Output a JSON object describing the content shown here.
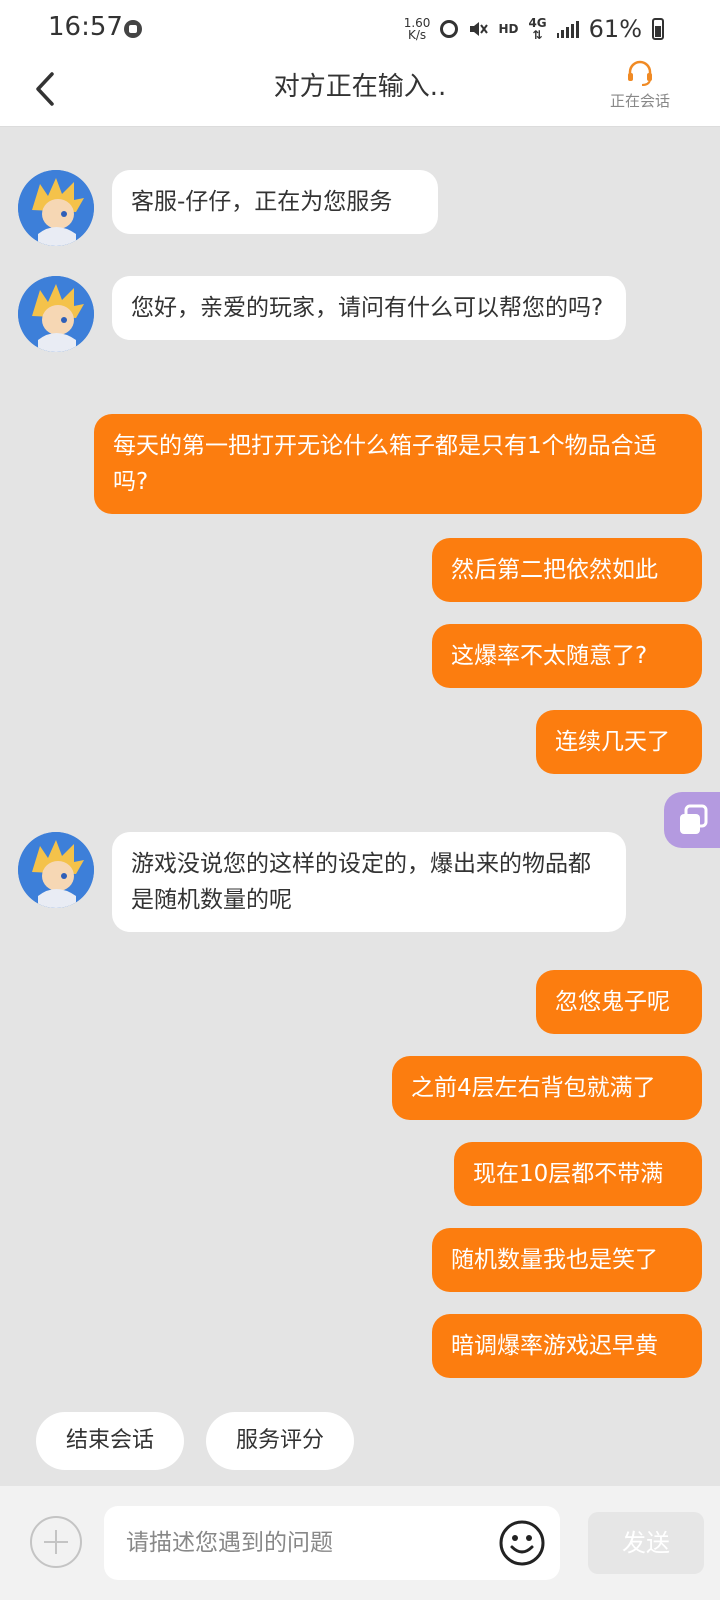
{
  "status_bar": {
    "time": "16:57",
    "net_speed_value": "1.60",
    "net_speed_unit": "K/s",
    "hd_label": "HD",
    "network_type": "4G",
    "battery_percent": "61%"
  },
  "header": {
    "title": "对方正在输入..",
    "service_status_label": "正在会话"
  },
  "messages": [
    {
      "sender": "agent",
      "text": "客服-仔仔，正在为您服务"
    },
    {
      "sender": "agent",
      "text": "您好，亲爱的玩家，请问有什么可以帮您的吗?"
    },
    {
      "sender": "user",
      "text": "每天的第一把打开无论什么箱子都是只有1个物品合适吗?"
    },
    {
      "sender": "user",
      "text": "然后第二把依然如此"
    },
    {
      "sender": "user",
      "text": "这爆率不太随意了?"
    },
    {
      "sender": "user",
      "text": "连续几天了"
    },
    {
      "sender": "agent",
      "text": "游戏没说您的这样的设定的，爆出来的物品都是随机数量的呢"
    },
    {
      "sender": "user",
      "text": "忽悠鬼子呢"
    },
    {
      "sender": "user",
      "text": "之前4层左右背包就满了"
    },
    {
      "sender": "user",
      "text": "现在10层都不带满"
    },
    {
      "sender": "user",
      "text": "随机数量我也是笑了"
    },
    {
      "sender": "user",
      "text": "暗调爆率游戏迟早黄"
    }
  ],
  "quick_actions": {
    "end_session": "结束会话",
    "rate_service": "服务评分"
  },
  "composer": {
    "placeholder": "请描述您遇到的问题",
    "send_label": "发送"
  },
  "colors": {
    "user_bubble": "#fc7d0f",
    "agent_bubble": "#ffffff",
    "chat_background": "#e4e4e4",
    "accent": "#f08a24"
  }
}
